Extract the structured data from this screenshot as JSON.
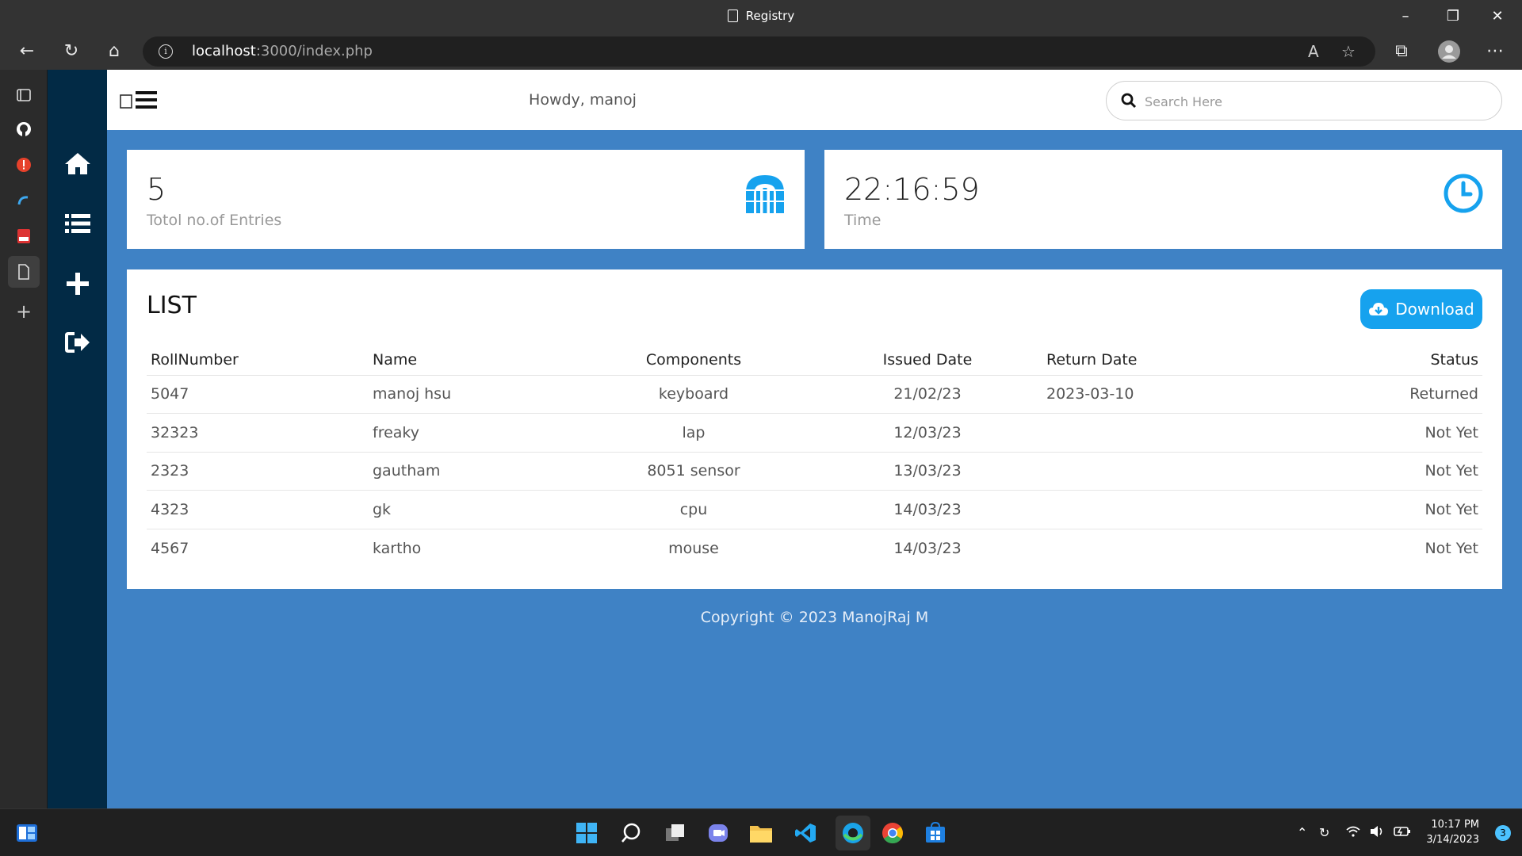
{
  "browser": {
    "window_title": "Registry",
    "url_host": "localhost",
    "url_path": ":3000/index.php"
  },
  "header": {
    "greeting": "Howdy, manoj",
    "search_placeholder": "Search Here"
  },
  "sidebar": {
    "items": [
      {
        "icon": "home-icon"
      },
      {
        "icon": "list-icon"
      },
      {
        "icon": "plus-icon"
      },
      {
        "icon": "logout-icon"
      }
    ]
  },
  "stats": {
    "entries_value": "5",
    "entries_label": "Totol no.of Entries",
    "time_value": "22:16:59",
    "time_label": "Time"
  },
  "list": {
    "title": "LIST",
    "download_label": "Download",
    "columns": [
      "RollNumber",
      "Name",
      "Components",
      "Issued Date",
      "Return Date",
      "Status"
    ],
    "rows": [
      [
        "5047",
        "manoj hsu",
        "keyboard",
        "21/02/23",
        "2023-03-10",
        "Returned"
      ],
      [
        "32323",
        "freaky",
        "lap",
        "12/03/23",
        "",
        "Not Yet"
      ],
      [
        "2323",
        "gautham",
        "8051 sensor",
        "13/03/23",
        "",
        "Not Yet"
      ],
      [
        "4323",
        "gk",
        "cpu",
        "14/03/23",
        "",
        "Not Yet"
      ],
      [
        "4567",
        "kartho",
        "mouse",
        "14/03/23",
        "",
        "Not Yet"
      ]
    ]
  },
  "footer": {
    "copyright": "Copyright © 2023 ManojRaj M"
  },
  "taskbar": {
    "time": "10:17 PM",
    "date": "3/14/2023",
    "notifications": "3"
  },
  "colors": {
    "page_bg": "#3f82c5",
    "sidebar_bg": "#022a45",
    "accent": "#16a2ee"
  }
}
